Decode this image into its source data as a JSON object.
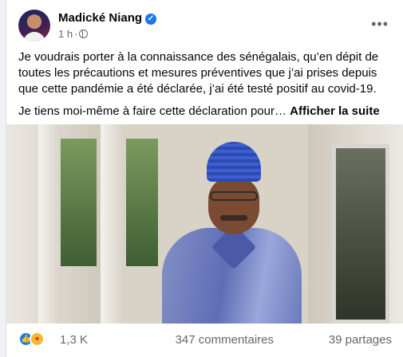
{
  "post": {
    "author": "Madické Niang",
    "time": "1 h",
    "paragraphs": [
      "Je voudrais porter à la connaissance des sénégalais, qu’en dépit de toutes les précautions et mesures préventives que j’ai prises depuis que cette pandémie a été déclarée, j’ai été testé positif au covid-19.",
      "Je tiens moi-même à faire cette déclaration pour…"
    ],
    "see_more": "Afficher la suite"
  },
  "footer": {
    "reactions_count": "1,3 K",
    "comments": "347 commentaires",
    "shares": "39 partages"
  },
  "icons": {
    "verified": "verified-badge-icon",
    "audience": "globe-icon",
    "more": "more-options-icon",
    "reaction1": "like-reaction-icon",
    "reaction2": "care-reaction-icon"
  },
  "colors": {
    "brand_blue": "#1877f2",
    "secondary_text": "#65676b",
    "primary_text": "#050505"
  }
}
